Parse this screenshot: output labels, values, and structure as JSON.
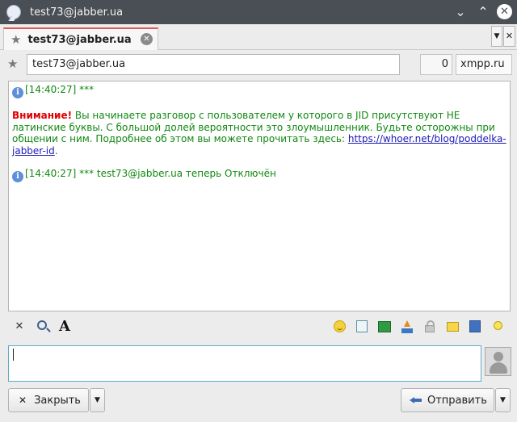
{
  "window": {
    "title": "test73@jabber.ua"
  },
  "tabs": [
    {
      "label": "test73@jabber.ua"
    }
  ],
  "contact": {
    "jid": "test73@jabber.ua",
    "counter": "0",
    "server": "xmpp.ru"
  },
  "chat": {
    "line1": "[14:40:27] ***",
    "warning_label": "Внимание!",
    "warning_text": " Вы начинаете разговор с пользователем у которого в JID присутствуют НЕ латинские буквы. С большой долей вероятности это злоумышленник. Будьте осторожны при общении с ним. Подробнее об этом вы можете прочитать здесь: ",
    "warning_link": "https://whoer.net/blog/poddelka-jabber-id",
    "warning_end": ".",
    "line2": "[14:40:27] *** test73@jabber.ua теперь Отключён"
  },
  "toolbar": {
    "clear_icon": "clear-icon",
    "find_icon": "find-icon",
    "font_glyph": "A",
    "right_icons": [
      "smile-icon",
      "send-file-icon",
      "share-icon",
      "upload-icon",
      "lock-icon",
      "message-icon",
      "book-icon",
      "idea-icon"
    ]
  },
  "input": {
    "value": ""
  },
  "buttons": {
    "close_label": "Закрыть",
    "send_label": "Отправить"
  },
  "colors": {
    "system_text": "#118811",
    "warning": "#e00000",
    "link": "#1a1ab8",
    "tab_accent": "#e05a5a",
    "titlebar": "#4a4f55"
  }
}
